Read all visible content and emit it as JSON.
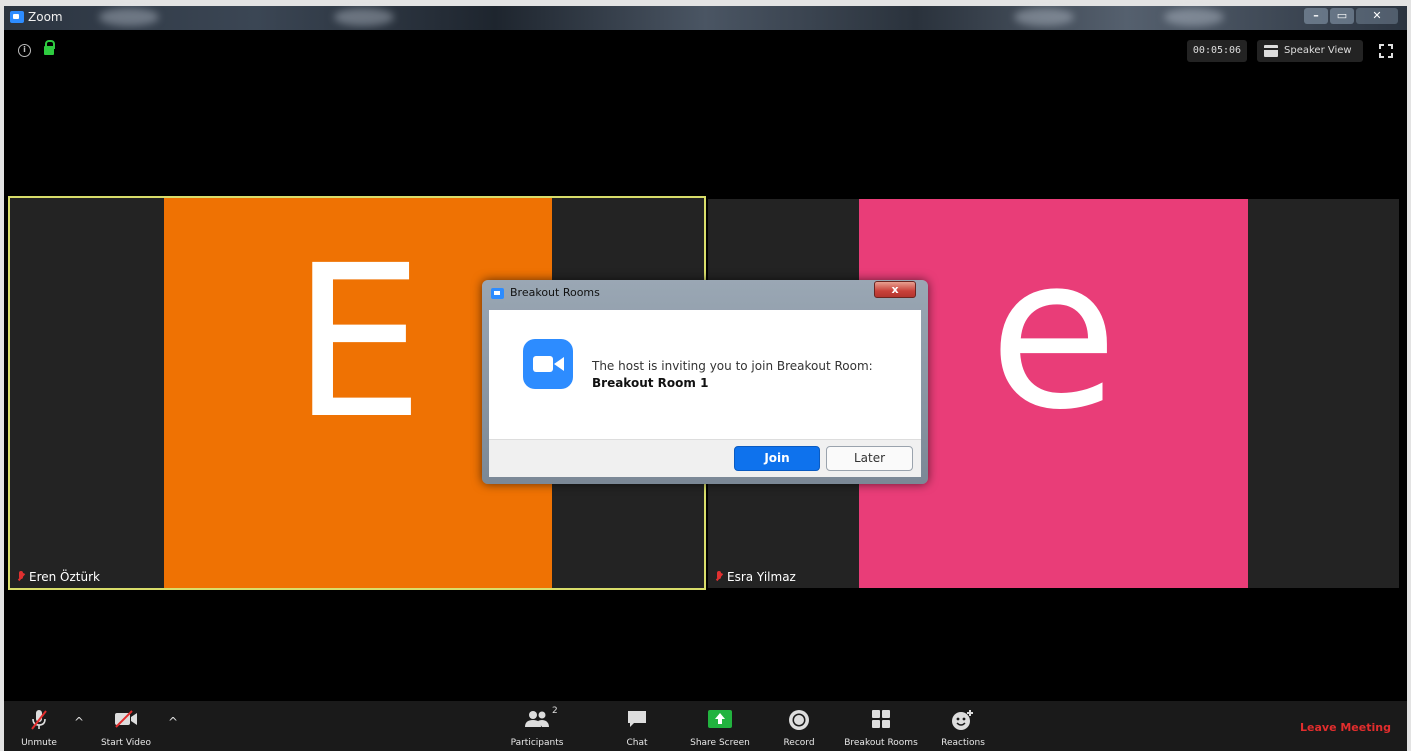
{
  "window": {
    "title": "Zoom",
    "min_label": "–",
    "max_label": "▭",
    "close_label": "✕"
  },
  "meeting": {
    "timer": "00:05:06",
    "view_mode": "Speaker View",
    "info_icon": "info-icon",
    "lock_icon": "lock-icon",
    "active_speaker_border": "#d8dd6a",
    "participants": [
      {
        "name": "Eren Öztürk",
        "initial": "E",
        "color": "#ef7203",
        "muted": true
      },
      {
        "name": "Esra Yilmaz",
        "initial": "e",
        "color": "#e93d78",
        "muted": true
      }
    ]
  },
  "dialog": {
    "title": "Breakout Rooms",
    "close_label": "x",
    "message": "The host is inviting you to join Breakout Room:",
    "room": "Breakout Room 1",
    "join_label": "Join",
    "later_label": "Later",
    "accent": "#0e72ed"
  },
  "toolbar": {
    "unmute": "Unmute",
    "start_video": "Start Video",
    "participants": "Participants",
    "participants_count": "2",
    "chat": "Chat",
    "share_screen": "Share Screen",
    "record": "Record",
    "breakout_rooms": "Breakout Rooms",
    "reactions": "Reactions",
    "leave": "Leave Meeting",
    "leave_color": "#e22d2d",
    "share_color": "#22b33f"
  }
}
